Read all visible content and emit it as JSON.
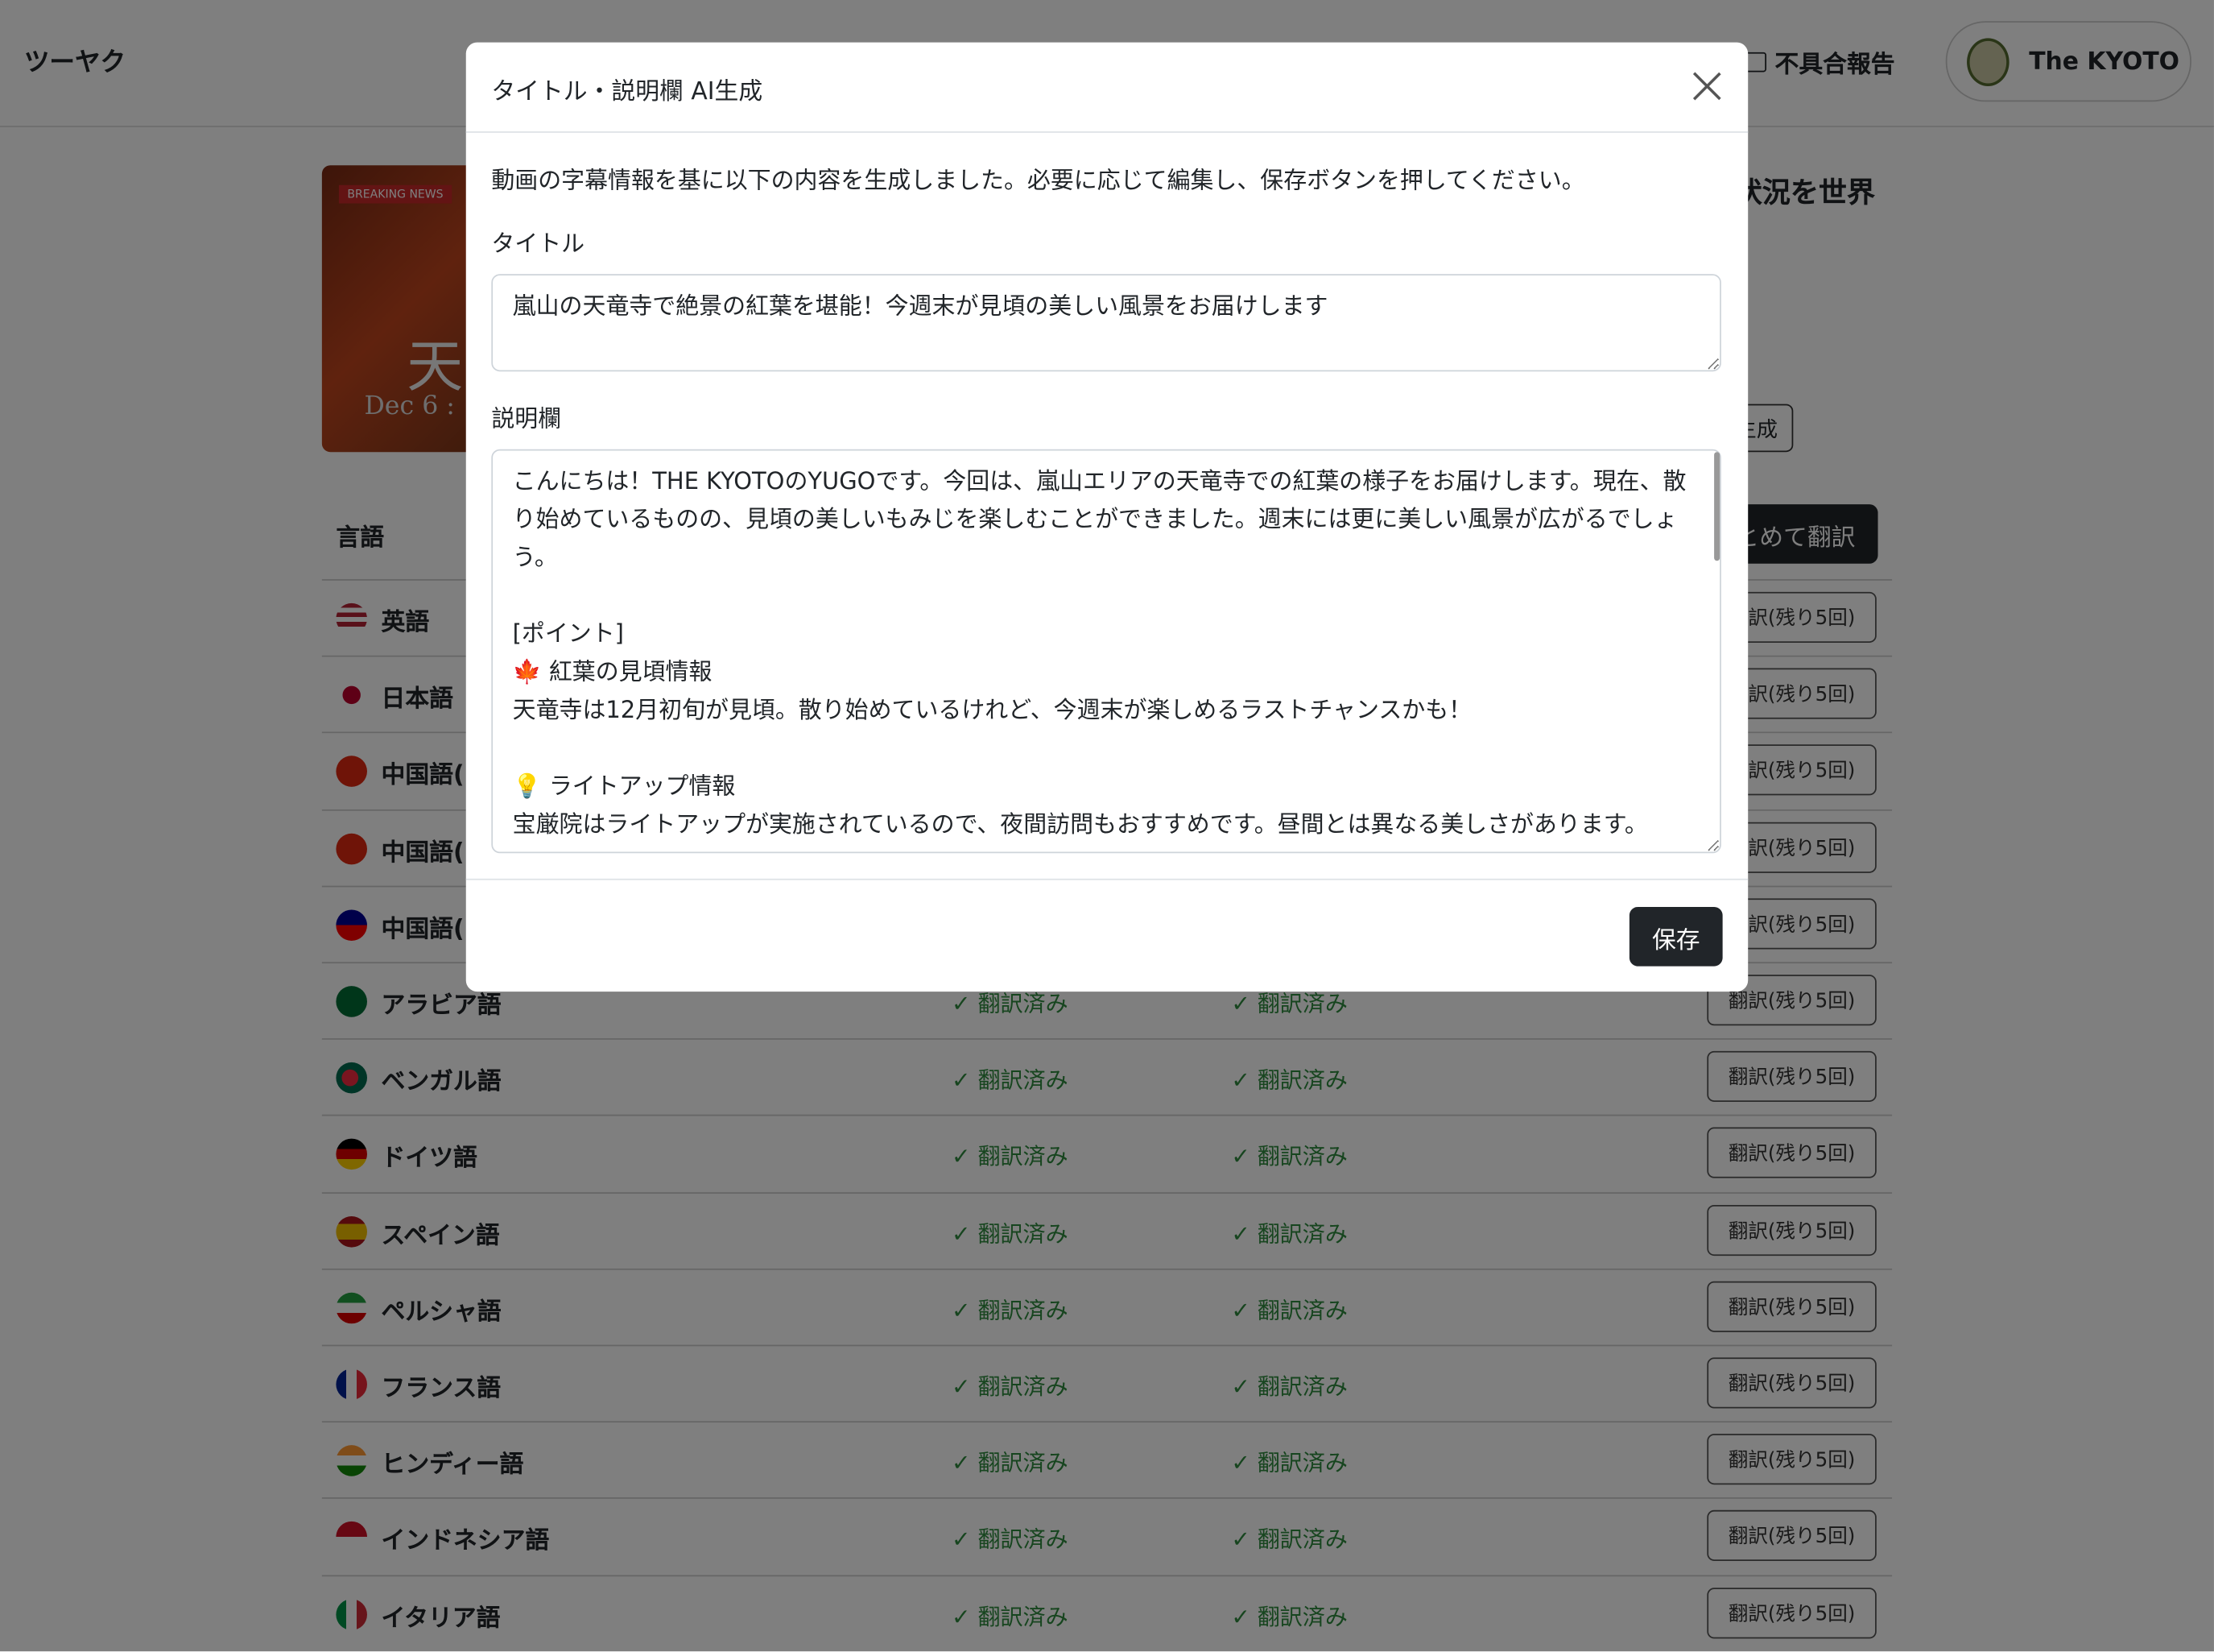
{
  "app": {
    "brand": "ツーヤク",
    "report_label": "不具合報告",
    "profile_name": "The KYOTO"
  },
  "video": {
    "thumbnail_badge": "BREAKING NEWS",
    "thumbnail_kanji": "天",
    "thumbnail_date": "Dec 6 :",
    "title_partial": "状況を世界",
    "generate_label": "生成",
    "bulk_translate_label": "まとめて翻訳"
  },
  "table": {
    "header_language": "言語",
    "rows": [
      {
        "name": "英語",
        "flag": "us",
        "status1": "",
        "status2": "",
        "button": "翻訳(残り5回)"
      },
      {
        "name": "日本語",
        "flag": "jp",
        "status1": "",
        "status2": "",
        "button": "翻訳(残り5回)"
      },
      {
        "name": "中国語(",
        "flag": "cn",
        "status1": "",
        "status2": "",
        "button": "翻訳(残り5回)"
      },
      {
        "name": "中国語(",
        "flag": "hk",
        "status1": "",
        "status2": "",
        "button": "翻訳(残り5回)"
      },
      {
        "name": "中国語(",
        "flag": "tw",
        "status1": "",
        "status2": "",
        "button": "翻訳(残り5回)"
      },
      {
        "name": "アラビア語",
        "flag": "sa",
        "status1": "✓ 翻訳済み",
        "status2": "✓ 翻訳済み",
        "button": "翻訳(残り5回)"
      },
      {
        "name": "ベンガル語",
        "flag": "bd",
        "status1": "✓ 翻訳済み",
        "status2": "✓ 翻訳済み",
        "button": "翻訳(残り5回)"
      },
      {
        "name": "ドイツ語",
        "flag": "de",
        "status1": "✓ 翻訳済み",
        "status2": "✓ 翻訳済み",
        "button": "翻訳(残り5回)"
      },
      {
        "name": "スペイン語",
        "flag": "es",
        "status1": "✓ 翻訳済み",
        "status2": "✓ 翻訳済み",
        "button": "翻訳(残り5回)"
      },
      {
        "name": "ペルシャ語",
        "flag": "ir",
        "status1": "✓ 翻訳済み",
        "status2": "✓ 翻訳済み",
        "button": "翻訳(残り5回)"
      },
      {
        "name": "フランス語",
        "flag": "fr",
        "status1": "✓ 翻訳済み",
        "status2": "✓ 翻訳済み",
        "button": "翻訳(残り5回)"
      },
      {
        "name": "ヒンディー語",
        "flag": "in",
        "status1": "✓ 翻訳済み",
        "status2": "✓ 翻訳済み",
        "button": "翻訳(残り5回)"
      },
      {
        "name": "インドネシア語",
        "flag": "id",
        "status1": "✓ 翻訳済み",
        "status2": "✓ 翻訳済み",
        "button": "翻訳(残り5回)"
      },
      {
        "name": "イタリア語",
        "flag": "it",
        "status1": "✓ 翻訳済み",
        "status2": "✓ 翻訳済み",
        "button": "翻訳(残り5回)"
      }
    ]
  },
  "modal": {
    "title": "タイトル・説明欄 AI生成",
    "intro": "動画の字幕情報を基に以下の内容を生成しました。必要に応じて編集し、保存ボタンを押してください。",
    "title_label": "タイトル",
    "title_value": "嵐山の天竜寺で絶景の紅葉を堪能！今週末が見頃の美しい風景をお届けします",
    "desc_label": "説明欄",
    "desc_value": "こんにちは！THE KYOTOのYUGOです。今回は、嵐山エリアの天竜寺での紅葉の様子をお届けします。現在、散り始めているものの、見頃の美しいもみじを楽しむことができました。週末には更に美しい風景が広がるでしょう。\n\n[ポイント]\n🍁 紅葉の見頃情報\n天竜寺は12月初旬が見頃。散り始めているけれど、今週末が楽しめるラストチャンスかも！\n\n💡 ライトアップ情報\n宝厳院はライトアップが実施されているので、夜間訪問もおすすめです。昼間とは異なる美しさがあります。",
    "save_label": "保存"
  },
  "colors": {
    "primary_dark": "#212529",
    "success": "#2e8b3e",
    "overlay": "rgba(0,0,0,0.5)"
  }
}
